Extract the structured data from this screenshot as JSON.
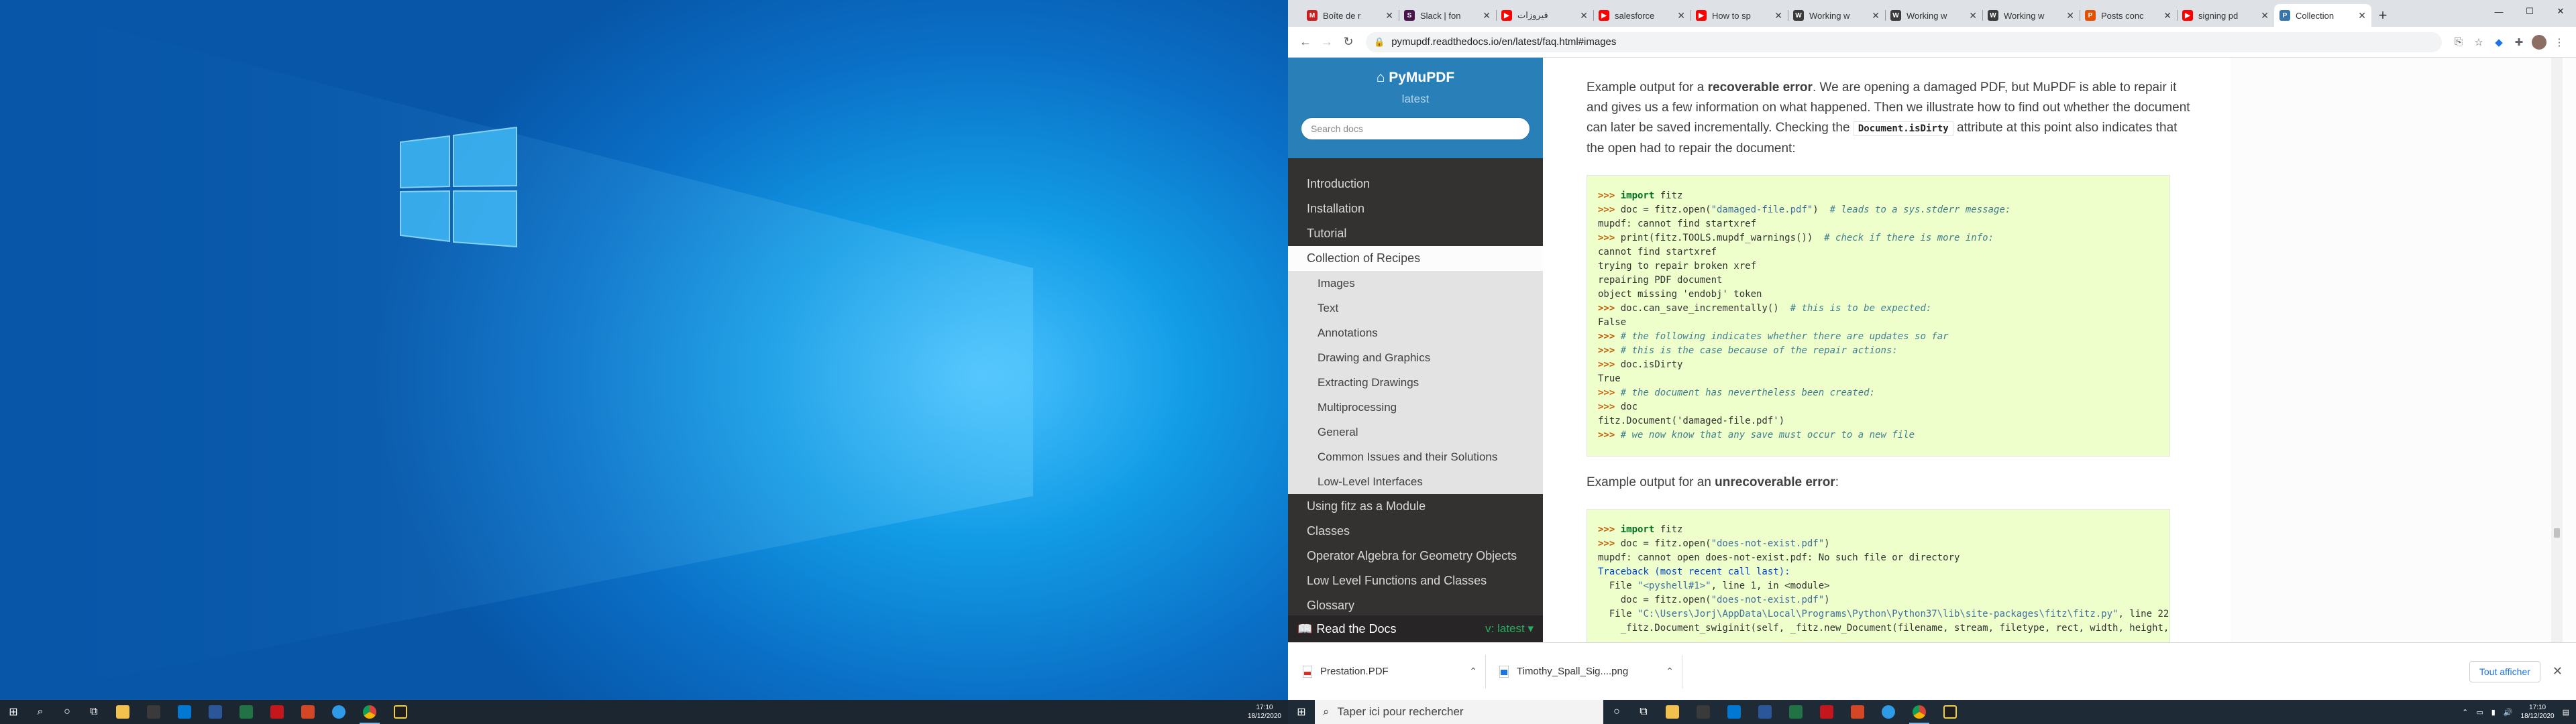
{
  "browser": {
    "tabs": [
      {
        "label": "Boîte de r",
        "fav_color": "#c5221f",
        "fav_glyph": "M"
      },
      {
        "label": "Slack | fon",
        "fav_color": "#4a154b",
        "fav_glyph": "S"
      },
      {
        "label": "فيروزات",
        "fav_color": "#ff0000",
        "fav_glyph": "▶"
      },
      {
        "label": "salesforce",
        "fav_color": "#ff0000",
        "fav_glyph": "▶"
      },
      {
        "label": "How to sp",
        "fav_color": "#ff0000",
        "fav_glyph": "▶"
      },
      {
        "label": "Working w",
        "fav_color": "#3a3a3a",
        "fav_glyph": "W"
      },
      {
        "label": "Working w",
        "fav_color": "#3a3a3a",
        "fav_glyph": "W"
      },
      {
        "label": "Working w",
        "fav_color": "#3a3a3a",
        "fav_glyph": "W"
      },
      {
        "label": "Posts conc",
        "fav_color": "#e65100",
        "fav_glyph": "P"
      },
      {
        "label": "signing pd",
        "fav_color": "#ff0000",
        "fav_glyph": "▶"
      },
      {
        "label": "Collection",
        "fav_color": "#3776ab",
        "fav_glyph": "P"
      }
    ],
    "url": "pymupdf.readthedocs.io/en/latest/faq.html#images"
  },
  "sidebar": {
    "brand": "PyMuPDF",
    "version": "latest",
    "search_placeholder": "Search docs",
    "items": [
      {
        "label": "Introduction",
        "kind": "top"
      },
      {
        "label": "Installation",
        "kind": "top"
      },
      {
        "label": "Tutorial",
        "kind": "top"
      },
      {
        "label": "Collection of Recipes",
        "kind": "current"
      },
      {
        "label": "Images",
        "kind": "sub"
      },
      {
        "label": "Text",
        "kind": "sub"
      },
      {
        "label": "Annotations",
        "kind": "sub"
      },
      {
        "label": "Drawing and Graphics",
        "kind": "sub"
      },
      {
        "label": "Extracting Drawings",
        "kind": "sub"
      },
      {
        "label": "Multiprocessing",
        "kind": "sub"
      },
      {
        "label": "General",
        "kind": "sub"
      },
      {
        "label": "Common Issues and their Solutions",
        "kind": "sub"
      },
      {
        "label": "Low-Level Interfaces",
        "kind": "sub"
      },
      {
        "label": "Using fitz as a Module",
        "kind": "top"
      },
      {
        "label": "Classes",
        "kind": "top"
      },
      {
        "label": "Operator Algebra for Geometry Objects",
        "kind": "top"
      },
      {
        "label": "Low Level Functions and Classes",
        "kind": "top"
      },
      {
        "label": "Glossary",
        "kind": "top"
      }
    ],
    "rtd_label": "Read the Docs",
    "rtd_version": "v: latest"
  },
  "article": {
    "p1_a": "Example output for a ",
    "p1_b": "recoverable error",
    "p1_c": ". We are opening a damaged PDF, but MuPDF is able to repair it and gives us a few information on what happened. Then we illustrate how to find out whether the document can later be saved incrementally. Checking the ",
    "p1_code": "Document.isDirty",
    "p1_d": " attribute at this point also indicates that the open had to repair the document:",
    "p2_a": "Example output for an ",
    "p2_b": "unrecoverable error",
    "p2_c": ":"
  },
  "downloads": {
    "items": [
      "Prestation.PDF",
      "Timothy_Spall_Sig....png"
    ],
    "show_all": "Tout afficher"
  },
  "taskbar": {
    "search_placeholder": "Taper ici pour rechercher",
    "time": "17:10",
    "date": "18/12/2020"
  },
  "colors": {
    "rtd_blue": "#2980b9",
    "sidebar_dark": "#343131",
    "code_bg": "#eeffcc"
  }
}
